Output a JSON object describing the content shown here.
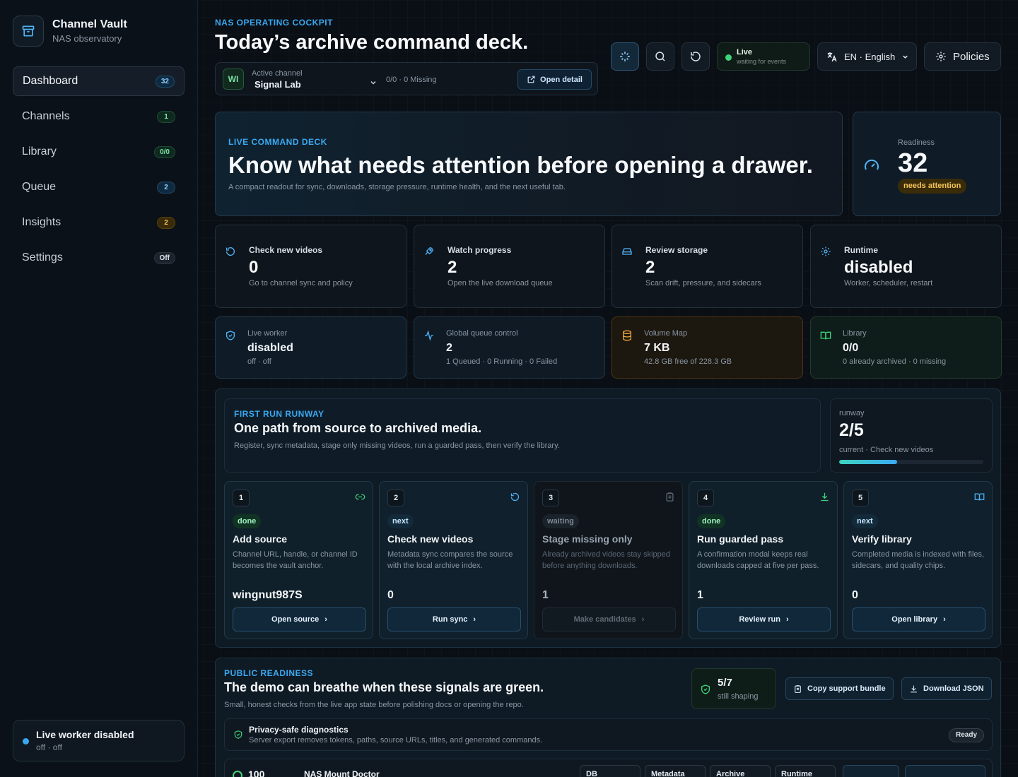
{
  "brand": {
    "title": "Channel Vault",
    "subtitle": "NAS observatory"
  },
  "sidebar": {
    "items": [
      {
        "label": "Dashboard",
        "badge": "32",
        "badge_tone": "blue"
      },
      {
        "label": "Channels",
        "badge": "1",
        "badge_tone": "green"
      },
      {
        "label": "Library",
        "badge": "0/0",
        "badge_tone": "green"
      },
      {
        "label": "Queue",
        "badge": "2",
        "badge_tone": "blue"
      },
      {
        "label": "Insights",
        "badge": "2",
        "badge_tone": "amber"
      },
      {
        "label": "Settings",
        "badge": "Off",
        "badge_tone": "gray"
      }
    ],
    "worker": {
      "title": "Live worker disabled",
      "subtitle": "off · off"
    }
  },
  "header": {
    "eyebrow": "NAS OPERATING COCKPIT",
    "title": "Today’s archive command deck.",
    "channel": {
      "initials": "WI",
      "label": "Active channel",
      "name": "Signal Lab",
      "missing": "0/0 · 0 Missing",
      "open_detail": "Open detail"
    },
    "live": {
      "title": "Live",
      "subtitle": "waiting for events"
    },
    "language": "EN · English",
    "policies": "Policies"
  },
  "hero": {
    "eyebrow": "LIVE COMMAND DECK",
    "title": "Know what needs attention before opening a drawer.",
    "subtitle": "A compact readout for sync, downloads, storage pressure, runtime health, and the next useful tab."
  },
  "readiness": {
    "label": "Readiness",
    "value": "32",
    "badge": "needs attention"
  },
  "stats": [
    {
      "title": "Check new videos",
      "value": "0",
      "sub": "Go to channel sync and policy",
      "icon": "refresh-icon"
    },
    {
      "title": "Watch progress",
      "value": "2",
      "sub": "Open the live download queue",
      "icon": "rocket-icon"
    },
    {
      "title": "Review storage",
      "value": "2",
      "sub": "Scan drift, pressure, and sidecars",
      "icon": "drive-icon"
    },
    {
      "title": "Runtime",
      "value": "disabled",
      "sub": "Worker, scheduler, restart",
      "icon": "gear-icon"
    }
  ],
  "minis": [
    {
      "label": "Live worker",
      "value": "disabled",
      "sub": "off · off",
      "icon": "shield-icon",
      "color": "#4fb3f6"
    },
    {
      "label": "Global queue control",
      "value": "2",
      "sub": "1 Queued · 0 Running · 0 Failed",
      "icon": "activity-icon",
      "color": "#4fb3f6"
    },
    {
      "label": "Volume Map",
      "value": "7 KB",
      "sub": "42.8 GB free of 228.3 GB",
      "icon": "database-icon",
      "color": "#f0a43a"
    },
    {
      "label": "Library",
      "value": "0/0",
      "sub": "0 already archived · 0 missing",
      "icon": "book-icon",
      "color": "#3fd47a"
    }
  ],
  "runway": {
    "eyebrow": "FIRST RUN RUNWAY",
    "title": "One path from source to archived media.",
    "subtitle": "Register, sync metadata, stage only missing videos, run a guarded pass, then verify the library.",
    "meter": {
      "label": "runway",
      "value": "2/5",
      "sub": "current · Check new videos",
      "progress": 0.4
    },
    "steps": [
      {
        "num": "1",
        "status": "done",
        "title": "Add source",
        "desc": "Channel URL, handle, or channel ID becomes the vault anchor.",
        "value": "wingnut987S",
        "button": "Open source",
        "icon": "link-icon"
      },
      {
        "num": "2",
        "status": "next",
        "title": "Check new videos",
        "desc": "Metadata sync compares the source with the local archive index.",
        "value": "0",
        "button": "Run sync",
        "icon": "refresh-icon"
      },
      {
        "num": "3",
        "status": "waiting",
        "title": "Stage missing only",
        "desc": "Already archived videos stay skipped before anything downloads.",
        "value": "1",
        "button": "Make candidates",
        "icon": "clipboard-icon"
      },
      {
        "num": "4",
        "status": "done",
        "title": "Run guarded pass",
        "desc": "A confirmation modal keeps real downloads capped at five per pass.",
        "value": "1",
        "button": "Review run",
        "icon": "download-icon"
      },
      {
        "num": "5",
        "status": "next",
        "title": "Verify library",
        "desc": "Completed media is indexed with files, sidecars, and quality chips.",
        "value": "0",
        "button": "Open library",
        "icon": "book-icon"
      }
    ]
  },
  "public": {
    "eyebrow": "PUBLIC READINESS",
    "title": "The demo can breathe when these signals are green.",
    "subtitle": "Small, honest checks from the live app state before polishing docs or opening the repo.",
    "score": {
      "value": "5/7",
      "sub": "still shaping"
    },
    "copy_button": "Copy support bundle",
    "download_button": "Download JSON",
    "diagnostics": {
      "title": "Privacy-safe diagnostics",
      "sub": "Server export removes tokens, paths, source URLs, titles, and generated commands.",
      "badge": "Ready"
    },
    "doctor": {
      "score": "100",
      "title": "NAS Mount Doctor",
      "chips": [
        "DB",
        "Metadata",
        "Archive",
        "Runtime"
      ]
    }
  }
}
